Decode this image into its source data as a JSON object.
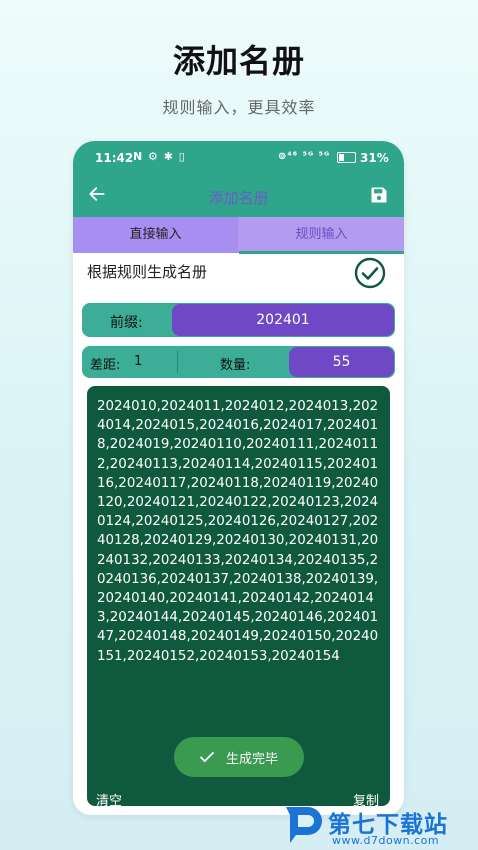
{
  "promo": {
    "title": "添加名册",
    "subtitle": "规则输入，更具效率"
  },
  "status_bar": {
    "time": "11:42",
    "left_icons": "N ⚙ ✱ ▯",
    "right_icons": "⊚⁴⁶ ⁵ᴳ ⁵ᴳ",
    "battery": "31%"
  },
  "app_bar": {
    "title": "添加名册",
    "back_icon": "arrow-left-icon",
    "save_icon": "save-icon"
  },
  "tabs": [
    {
      "label": "直接输入",
      "active": true
    },
    {
      "label": "规则输入",
      "active": false
    }
  ],
  "form": {
    "section_label": "根据规则生成名册",
    "prefix_label": "前缀:",
    "prefix_value": "202401",
    "gap_label": "差距:",
    "gap_value": "1",
    "count_label": "数量:",
    "count_value": "55"
  },
  "output": {
    "text": "2024010,2024011,2024012,2024013,2024014,2024015,2024016,2024017,2024018,2024019,20240110,20240111,20240112,20240113,20240114,20240115,20240116,20240117,20240118,20240119,20240120,20240121,20240122,20240123,20240124,20240125,20240126,20240127,20240128,20240129,20240130,20240131,20240132,20240133,20240134,20240135,20240136,20240137,20240138,20240139,20240140,20240141,20240142,20240143,20240144,20240145,20240146,20240147,20240148,20240149,20240150,20240151,20240152,20240153,20240154",
    "done_label": "生成完毕",
    "clear_label": "清空",
    "copy_label": "复制"
  },
  "watermark": {
    "name": "第七下载站",
    "url": "www.d7down.com"
  },
  "colors": {
    "primary": "#2fa58c",
    "purple": "#6f49c5",
    "tab_bg": "#b59bf0",
    "output_bg": "#0f5a3e",
    "done_button": "#3a9a4f"
  }
}
